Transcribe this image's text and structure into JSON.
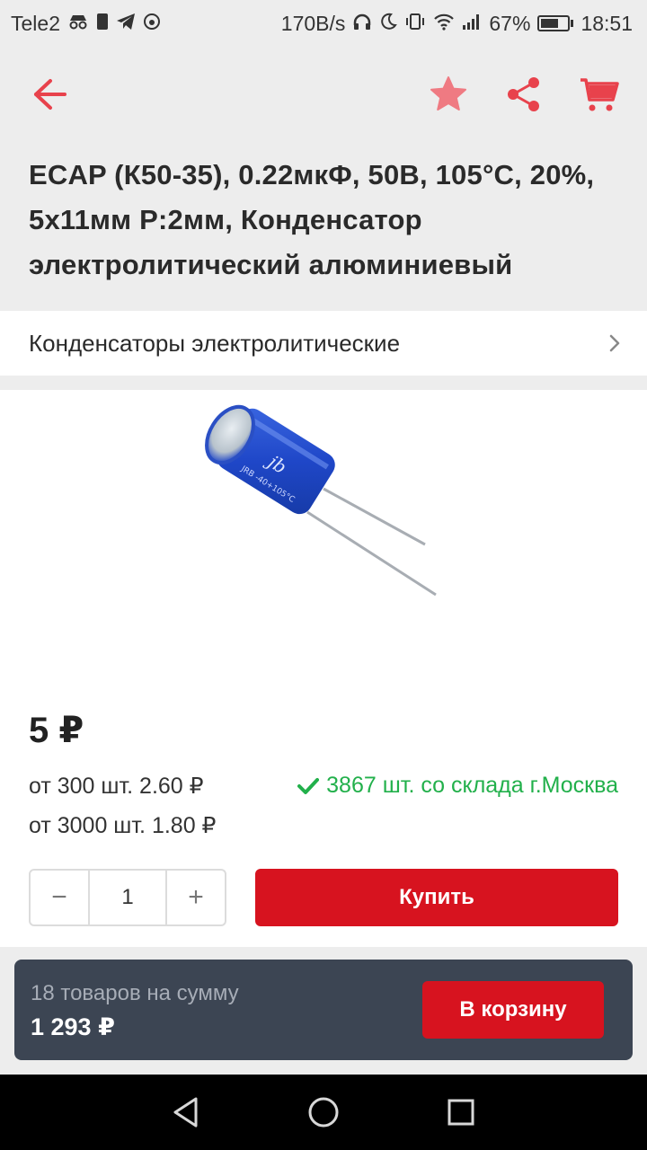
{
  "status_bar": {
    "carrier": "Tele2",
    "net_speed": "170B/s",
    "battery_percent": "67%",
    "battery_level": 0.67,
    "time": "18:51"
  },
  "header": {
    "title": "ECAP (К50-35), 0.22мкФ, 50В, 105°C, 20%, 5х11мм P:2мм, Конденсатор электролитический алюминиевый",
    "icons": [
      "back-arrow-icon",
      "star-icon",
      "share-icon",
      "cart-icon"
    ],
    "accent_color": "#e8424c"
  },
  "category": {
    "label": "Конденсаторы электролитические"
  },
  "product": {
    "price": "5 ₽",
    "tiers": [
      "от 300 шт. 2.60 ₽",
      "от 3000 шт. 1.80 ₽"
    ],
    "stock": "3867 шт. со склада г.Москва",
    "stock_color": "#22b04b",
    "quantity": "1",
    "qty_minus": "−",
    "qty_plus": "+",
    "buy_label": "Купить",
    "buy_color": "#d7131f"
  },
  "cart_bar": {
    "caption": "18 товаров на сумму",
    "total": "1 293 ₽",
    "button_label": "В корзину"
  },
  "nav_bar": {
    "icons": [
      "back-triangle-icon",
      "home-circle-icon",
      "recents-square-icon"
    ]
  }
}
